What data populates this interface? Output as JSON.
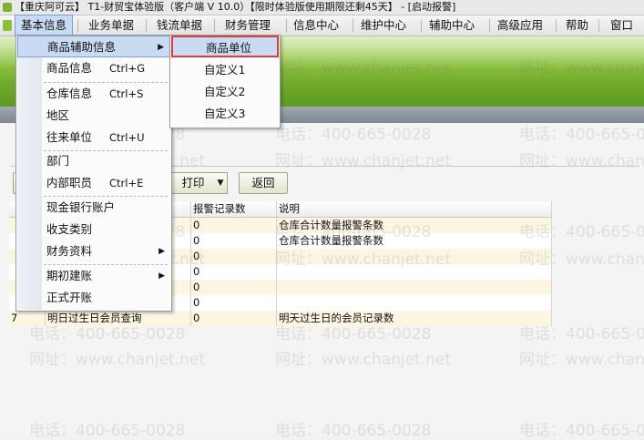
{
  "title": "【重庆阿可云】 T1-财贸宝体验版（客户端 V 10.0）【限时体验版使用期限还剩45天】 - [启动报警]",
  "menubar": [
    "基本信息",
    "业务单据",
    "钱流单据",
    "财务管理",
    "信息中心",
    "维护中心",
    "辅助中心",
    "高级应用",
    "帮助",
    "窗口"
  ],
  "dropdown": {
    "items": [
      {
        "label": "商品辅助信息",
        "shortcut": "",
        "submenu": true
      },
      {
        "label": "商品信息",
        "shortcut": "Ctrl+G",
        "submenu": false
      },
      {
        "label": "仓库信息",
        "shortcut": "Ctrl+S",
        "submenu": false
      },
      {
        "label": "地区",
        "shortcut": "",
        "submenu": false
      },
      {
        "label": "往来单位",
        "shortcut": "Ctrl+U",
        "submenu": false
      },
      {
        "label": "部门",
        "shortcut": "",
        "submenu": false
      },
      {
        "label": "内部职员",
        "shortcut": "Ctrl+E",
        "submenu": false
      },
      {
        "label": "现金银行账户",
        "shortcut": "",
        "submenu": false
      },
      {
        "label": "收支类别",
        "shortcut": "",
        "submenu": false
      },
      {
        "label": "财务资料",
        "shortcut": "",
        "submenu": true
      },
      {
        "label": "期初建账",
        "shortcut": "",
        "submenu": true
      },
      {
        "label": "正式开账",
        "shortcut": "",
        "submenu": false
      }
    ],
    "submenu_arrow": "▶"
  },
  "submenu": {
    "items": [
      "商品单位",
      "自定义1",
      "自定义2",
      "自定义3"
    ]
  },
  "toolbar": {
    "print_label": "打印",
    "dropdown_arrow": "▼",
    "back_label": "返回"
  },
  "table": {
    "headers": [
      "",
      "",
      "报警记录数",
      "说明"
    ],
    "rows": [
      {
        "num": "",
        "name": "",
        "count": "0",
        "desc": "仓库合计数量报警条数"
      },
      {
        "num": "",
        "name": "",
        "count": "0",
        "desc": "仓库合计数量报警条数"
      },
      {
        "num": "",
        "name": "",
        "count": "0",
        "desc": ""
      },
      {
        "num": "",
        "name": "",
        "count": "0",
        "desc": ""
      },
      {
        "num": "",
        "name": "",
        "count": "0",
        "desc": ""
      },
      {
        "num": "",
        "name": "",
        "count": "0",
        "desc": ""
      },
      {
        "num": "7",
        "name": "明日过生日会员查询",
        "count": "0",
        "desc": "明天过生日的会员记录数"
      }
    ]
  },
  "watermarks": {
    "phone": "电话：400-665-0028",
    "url": "网址：www.chanjet.net"
  },
  "colors": {
    "menu_highlight": "#c9daf3",
    "submenu_border": "#e03a3a",
    "banner": "#8fc340"
  }
}
